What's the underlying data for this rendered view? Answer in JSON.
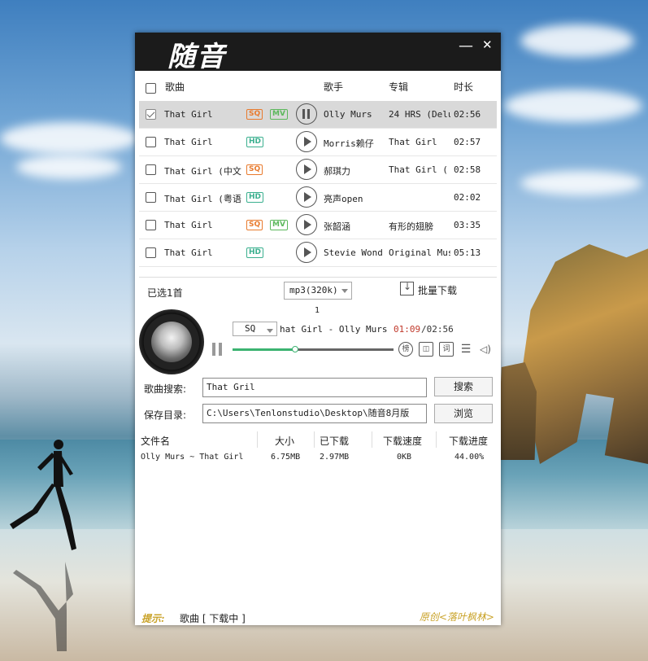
{
  "app": {
    "logo": "随音",
    "minimize": "—",
    "close": "✕"
  },
  "columns": {
    "song": "歌曲",
    "singer": "歌手",
    "album": "专辑",
    "duration": "时长"
  },
  "songs": [
    {
      "title": "That Girl",
      "badges": [
        "SQ",
        "MV"
      ],
      "singer": "Olly Murs",
      "album": "24 HRS (Delu",
      "duration": "02:56",
      "selected": true,
      "playing": true
    },
    {
      "title": "That Girl",
      "badges": [
        "HD"
      ],
      "singer": "Morris赖仔",
      "album": "That Girl",
      "duration": "02:57",
      "selected": false,
      "playing": false
    },
    {
      "title": "That Girl (中文",
      "badges": [
        "SQ"
      ],
      "singer": "郝琪力",
      "album": "That Girl (",
      "duration": "02:58",
      "selected": false,
      "playing": false
    },
    {
      "title": "That Girl (粤语",
      "badges": [
        "HD"
      ],
      "singer": "亮声open",
      "album": "",
      "duration": "02:02",
      "selected": false,
      "playing": false
    },
    {
      "title": "That Girl",
      "badges": [
        "SQ",
        "MV"
      ],
      "singer": "张韶涵",
      "album": "有形的翅膀",
      "duration": "03:35",
      "selected": false,
      "playing": false
    },
    {
      "title": "That Girl",
      "badges": [
        "HD"
      ],
      "singer": "Stevie Wond",
      "album": "Original Mus",
      "duration": "05:13",
      "selected": false,
      "playing": false
    }
  ],
  "controls": {
    "selected_count": "已选1首",
    "format": "mp3(320k)",
    "batch_download": "批量下载",
    "page": "1"
  },
  "player": {
    "quality": "SQ",
    "now_playing": "hat Girl - Olly Murs",
    "time_current": "01:09",
    "time_sep": "/",
    "time_total": "02:56",
    "progress": 0.39,
    "btn_rank": "榜",
    "btn_radio": "◫",
    "btn_lyrics": "词",
    "btn_list": "☰",
    "btn_volume": "◁)"
  },
  "search": {
    "label": "歌曲搜索:",
    "value": "That Gril",
    "button": "搜索"
  },
  "save": {
    "label": "保存目录:",
    "value": "C:\\Users\\Tenlonstudio\\Desktop\\随音8月版",
    "button": "浏览"
  },
  "downloads": {
    "headers": {
      "file": "文件名",
      "size": "大小",
      "downloaded": "已下载",
      "speed": "下载速度",
      "progress": "下载进度"
    },
    "rows": [
      {
        "file": "Olly Murs ~ That Girl",
        "size": "6.75MB",
        "downloaded": "2.97MB",
        "speed": "0KB",
        "progress": "44.00%"
      }
    ]
  },
  "footer": {
    "tip_prefix": "提示:",
    "tip": "歌曲 [ 下载中 ]",
    "credit": "原创<落叶枫林>"
  }
}
